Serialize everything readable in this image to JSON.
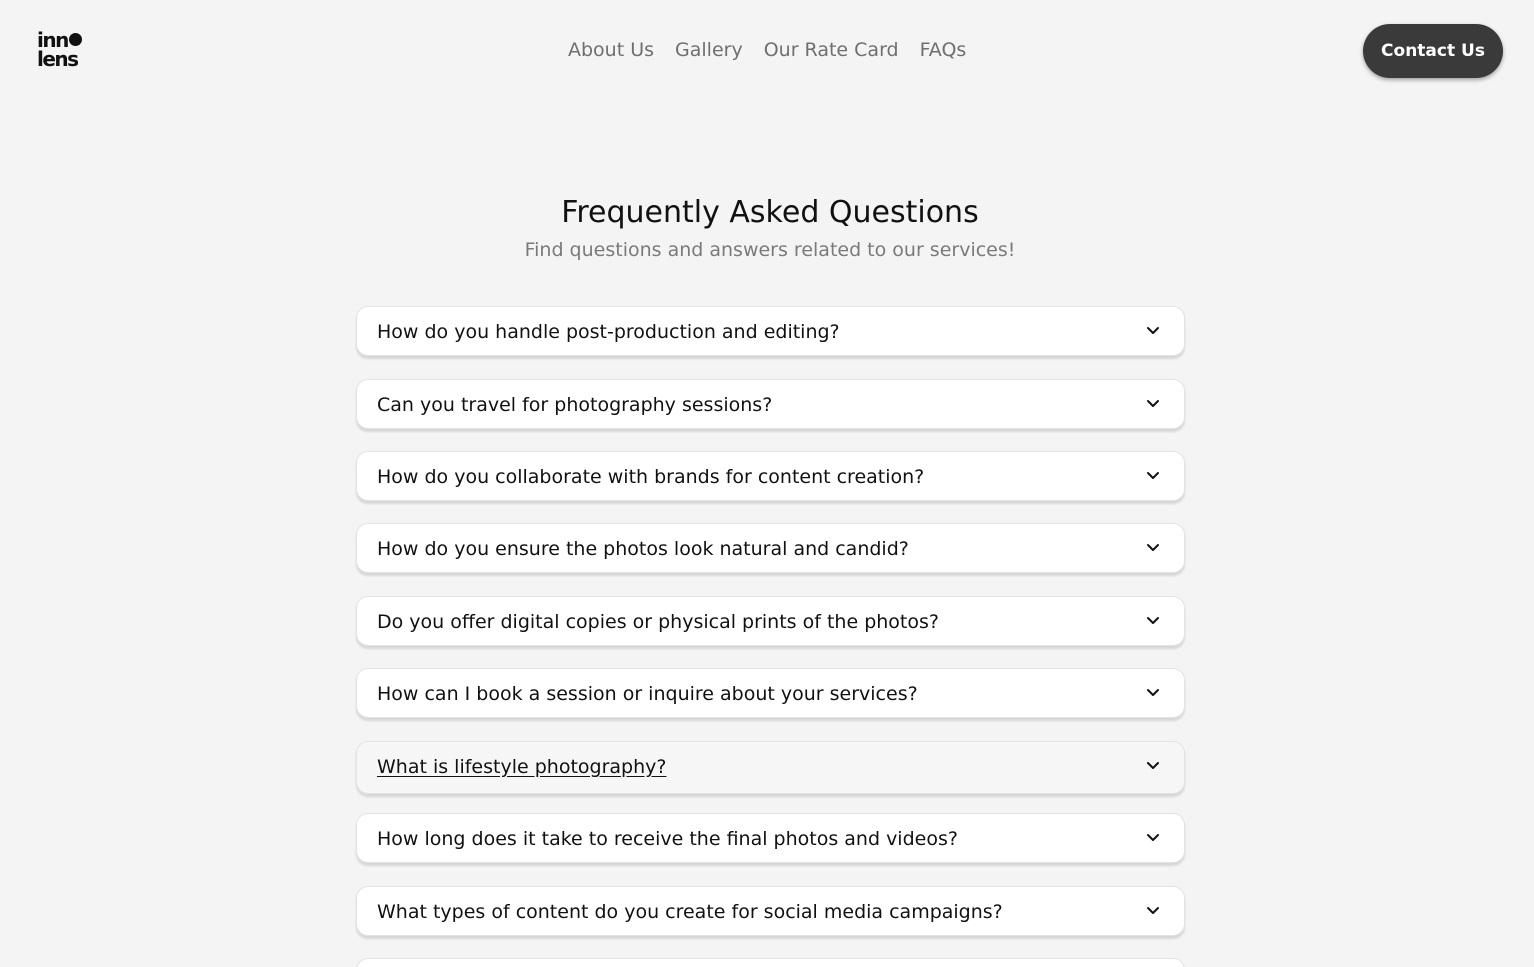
{
  "header": {
    "logo_line1": "inno",
    "logo_line2": "lens",
    "nav": [
      "About Us",
      "Gallery",
      "Our Rate Card",
      "FAQs"
    ],
    "contact_label": "Contact Us"
  },
  "main": {
    "title": "Frequently Asked Questions",
    "subtitle": "Find questions and answers related to our services!",
    "faqs": [
      "How do you handle post-production and editing?",
      "Can you travel for photography sessions?",
      "How do you collaborate with brands for content creation?",
      "How do you ensure the photos look natural and candid?",
      "Do you offer digital copies or physical prints of the photos?",
      "How can I book a session or inquire about your services?",
      "What is lifestyle photography?",
      "How long does it take to receive the final photos and videos?",
      "What types of content do you create for social media campaigns?"
    ],
    "hovered_faq_index": 6
  },
  "icons": {
    "faq_toggle": "chevron-down-icon"
  },
  "colors": {
    "background": "#f4f4f4",
    "button": "#3a3a3a",
    "nav_text": "#6f6f6f",
    "subtitle_text": "#7a7a7a"
  }
}
